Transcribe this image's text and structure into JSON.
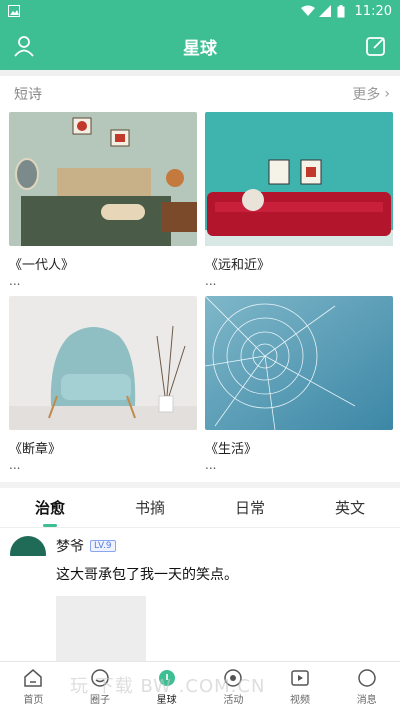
{
  "status": {
    "time": "11:20"
  },
  "header": {
    "title": "星球"
  },
  "section": {
    "label": "短诗",
    "more": "更多"
  },
  "cards": [
    {
      "caption": "《一代人》",
      "desc": "..."
    },
    {
      "caption": "《远和近》",
      "desc": "..."
    },
    {
      "caption": "《断章》",
      "desc": "..."
    },
    {
      "caption": "《生活》",
      "desc": "..."
    }
  ],
  "tabs": [
    "治愈",
    "书摘",
    "日常",
    "英文"
  ],
  "post": {
    "user": "梦爷",
    "level": "LV.9",
    "text": "这大哥承包了我一天的笑点。"
  },
  "nav": [
    "首页",
    "圈子",
    "星球",
    "活动",
    "视频",
    "消息"
  ],
  "watermark": "玩 下载 BW   .COM.CN",
  "colors": {
    "accent": "#3dbf93"
  }
}
